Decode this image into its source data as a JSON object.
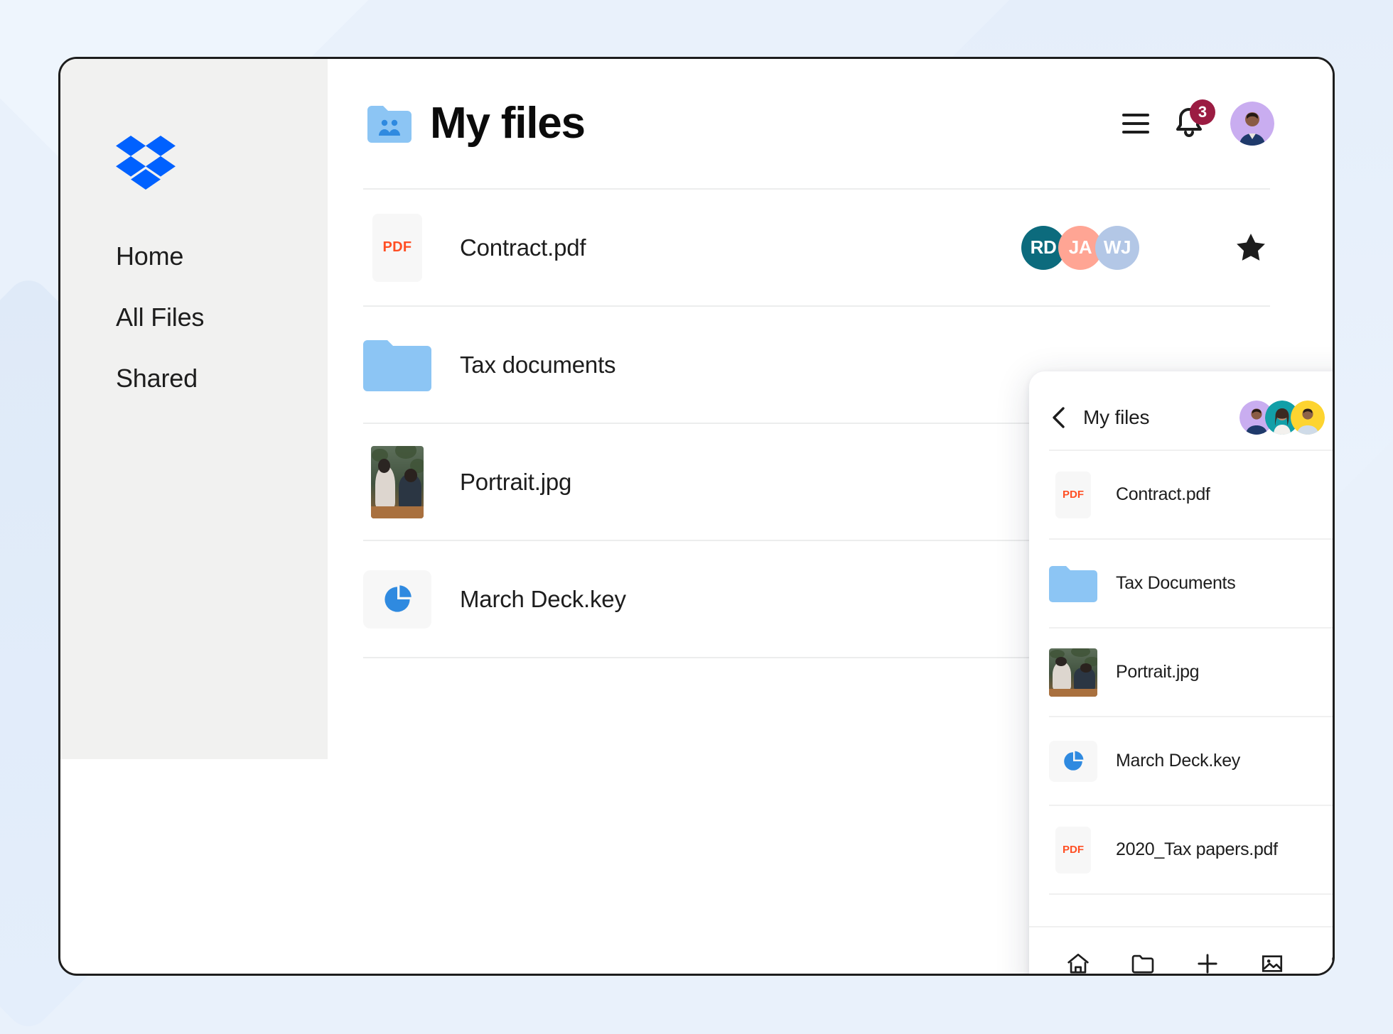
{
  "colors": {
    "background": "#e9f1fb",
    "card_border": "#1d1d1d",
    "sidebar_bg": "#f1f1f0",
    "brand_blue": "#0061ff",
    "folder_blue": "#8cc5f4",
    "pdf_orange": "#ff4f24",
    "badge_red": "#9b1c42",
    "avatar_rd": "#0c6b7d",
    "avatar_ja": "#ffa594",
    "avatar_wj": "#b3c7e6",
    "mp_avatar_1": "#c9adf0",
    "mp_avatar_2": "#129fa8",
    "mp_avatar_3": "#fdd430"
  },
  "sidebar": {
    "logo_name": "dropbox-logo",
    "items": [
      {
        "label": "Home",
        "name": "sidebar-item-home"
      },
      {
        "label": "All Files",
        "name": "sidebar-item-all-files"
      },
      {
        "label": "Shared",
        "name": "sidebar-item-shared"
      }
    ]
  },
  "header": {
    "title": "My files",
    "folder_icon": "shared-folder-icon",
    "menu_icon": "hamburger-menu-icon",
    "bell_icon": "notification-bell-icon",
    "notification_count": "3",
    "avatar_name": "user-avatar"
  },
  "file_list": {
    "rows": [
      {
        "name": "Contract.pdf",
        "thumb": "pdf",
        "thumb_label": "PDF",
        "starred": true,
        "shared_with": [
          {
            "initials": "RD",
            "color": "#0c6b7d"
          },
          {
            "initials": "JA",
            "color": "#ffa594"
          },
          {
            "initials": "WJ",
            "color": "#b3c7e6"
          }
        ]
      },
      {
        "name": "Tax documents",
        "thumb": "folder",
        "thumb_label": "",
        "starred": false,
        "shared_with": []
      },
      {
        "name": "Portrait.jpg",
        "thumb": "photo",
        "thumb_label": "",
        "starred": false,
        "shared_with": []
      },
      {
        "name": "March Deck.key",
        "thumb": "key",
        "thumb_label": "",
        "starred": false,
        "shared_with": []
      }
    ]
  },
  "mobile_panel": {
    "back_icon": "back-chevron-icon",
    "title": "My files",
    "overflow_icon": "more-options-icon",
    "avatars": [
      {
        "name": "collaborator-avatar-1",
        "color": "#c9adf0"
      },
      {
        "name": "collaborator-avatar-2",
        "color": "#129fa8"
      },
      {
        "name": "collaborator-avatar-3",
        "color": "#fdd430"
      }
    ],
    "rows": [
      {
        "name": "Contract.pdf",
        "thumb": "pdf",
        "thumb_label": "PDF",
        "starred": true
      },
      {
        "name": "Tax Documents",
        "thumb": "folder",
        "thumb_label": "",
        "starred": false
      },
      {
        "name": "Portrait.jpg",
        "thumb": "photo",
        "thumb_label": "",
        "starred": false
      },
      {
        "name": "March Deck.key",
        "thumb": "key",
        "thumb_label": "",
        "starred": false
      },
      {
        "name": "2020_Tax papers.pdf",
        "thumb": "pdf",
        "thumb_label": "PDF",
        "starred": false
      }
    ],
    "tabs": [
      {
        "icon": "home-icon"
      },
      {
        "icon": "folder-icon"
      },
      {
        "icon": "plus-icon"
      },
      {
        "icon": "photos-icon"
      },
      {
        "icon": "account-icon"
      }
    ]
  }
}
